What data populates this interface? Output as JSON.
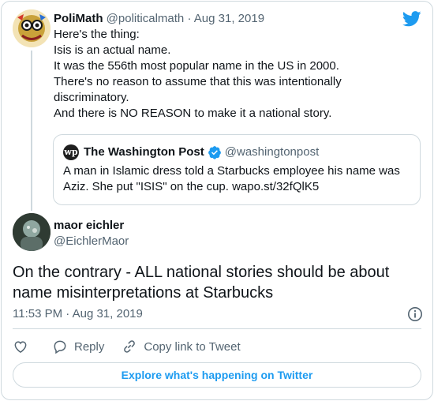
{
  "parent_tweet": {
    "name": "PoliMath",
    "handle": "@politicalmath",
    "separator": "·",
    "date": "Aug 31, 2019",
    "lines": [
      "Here's the thing:",
      "Isis is an actual name.",
      "It was the 556th most popular name in the US in 2000.",
      "There's no reason to assume that this was intentionally",
      "discriminatory.",
      "And there is NO REASON to make it a national story."
    ]
  },
  "quoted_tweet": {
    "logo_text": "wp",
    "name": "The Washington Post",
    "handle": "@washingtonpost",
    "text": "A man in Islamic dress told a Starbucks employee his name was Aziz. She put \"ISIS\" on the cup. wapo.st/32fQlK5"
  },
  "reply_tweet": {
    "name": "maor eichler",
    "handle": "@EichlerMaor",
    "text": "On the contrary - ALL national stories should be about name misinterpretations at Starbucks",
    "time": "11:53 PM",
    "separator": "·",
    "date": "Aug 31, 2019"
  },
  "actions": {
    "reply_label": "Reply",
    "copy_label": "Copy link to Tweet"
  },
  "explore_label": "Explore what's happening on Twitter",
  "colors": {
    "accent": "#1d9bf0",
    "text": "#0f1419",
    "muted": "#536471",
    "border": "#cfd9de"
  },
  "icons": [
    "twitter-bird-icon",
    "verified-badge-icon",
    "info-icon",
    "heart-icon",
    "reply-bubble-icon",
    "link-icon"
  ]
}
